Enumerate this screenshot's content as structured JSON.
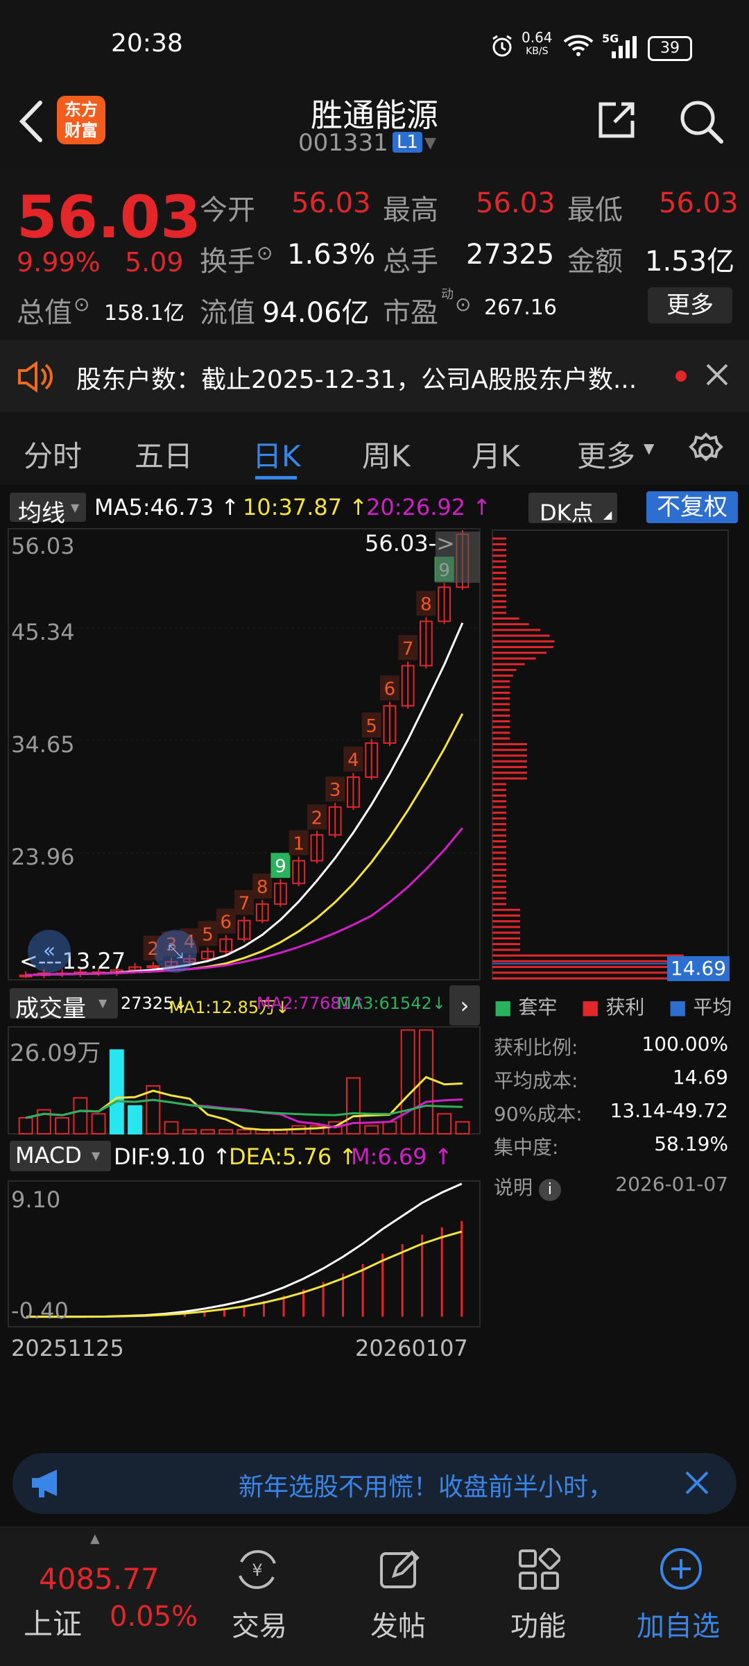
{
  "status": {
    "time": "20:38",
    "speed_value": "0.64",
    "speed_unit": "KB/S",
    "network": "5G",
    "battery": "39"
  },
  "header": {
    "title": "胜通能源",
    "code": "001331",
    "level_badge": "L1",
    "logo_text_1": "东方",
    "logo_text_2": "财富"
  },
  "quote": {
    "price": "56.03",
    "change_pct": "9.99%",
    "change": "5.09",
    "open_label": "今开",
    "open": "56.03",
    "high_label": "最高",
    "high": "56.03",
    "low_label": "最低",
    "low": "56.03",
    "turnover_label": "换手",
    "turnover": "1.63%",
    "volume_label": "总手",
    "volume": "27325",
    "amount_label": "金额",
    "amount": "1.53亿",
    "total_mv_label": "总值",
    "total_mv": "158.1亿",
    "float_mv_label": "流值",
    "float_mv": "94.06亿",
    "pe_label": "市盈",
    "pe_sup": "动",
    "pe": "267.16",
    "more_label": "更多"
  },
  "notice": {
    "text": "股东户数：截止2025-12-31，公司A股股东户数..."
  },
  "tabs": [
    {
      "label": "分时"
    },
    {
      "label": "五日"
    },
    {
      "label": "日K"
    },
    {
      "label": "周K"
    },
    {
      "label": "月K"
    },
    {
      "label": "更多"
    }
  ],
  "ma_bar": {
    "selector": "均线",
    "ma5": "MA5:46.73",
    "ma10": "10:37.87",
    "ma20": "20:26.92",
    "dk": "DK点",
    "fq": "不复权"
  },
  "kline": {
    "y_labels": [
      "56.03",
      "45.34",
      "34.65",
      "23.96"
    ],
    "max_marker": "56.03->",
    "min_marker": "<---13.27",
    "seq_numbers": [
      "2",
      "3",
      "4",
      "5",
      "6",
      "7",
      "8",
      "9",
      "1",
      "2",
      "3",
      "4",
      "5",
      "6",
      "7",
      "8",
      "9"
    ],
    "colors": {
      "up": "#e2262a",
      "ma5": "#ffffff",
      "ma10": "#f5e53a",
      "ma20": "#d21fc9",
      "green": "#29b35a"
    }
  },
  "chip": {
    "price_tag": "14.69",
    "legend": [
      "套牢",
      "获利",
      "平均"
    ],
    "rows": [
      {
        "label": "获利比例:",
        "value": "100.00%"
      },
      {
        "label": "平均成本:",
        "value": "14.69"
      },
      {
        "label": "90%成本:",
        "value": "13.14-49.72"
      },
      {
        "label": "集中度:",
        "value": "58.19%"
      }
    ],
    "note_label": "说明",
    "date": "2026-01-07"
  },
  "volume": {
    "selector": "成交量",
    "vol": "27325",
    "ma1": "MA1:12.85万",
    "ma2": "MA2:77681",
    "ma3": "MA3:61542",
    "max_label": "26.09万"
  },
  "macd": {
    "selector": "MACD",
    "dif": "DIF:9.10",
    "dea": "DEA:5.76",
    "m": "M:6.69",
    "top_label": "9.10",
    "bottom_label": "-0.40"
  },
  "dates": {
    "start": "20251125",
    "end": "20260107"
  },
  "banner": {
    "text": "新年选股不用慌！收盘前半小时，"
  },
  "bottom_nav": {
    "index_value": "4085.77",
    "index_name": "上证",
    "index_change": "0.05%",
    "items": [
      {
        "label": "交易"
      },
      {
        "label": "发帖"
      },
      {
        "label": "功能"
      },
      {
        "label": "加自选"
      }
    ]
  },
  "chart_data": {
    "type": "candlestick",
    "x_range": [
      "20251125",
      "20260107"
    ],
    "ylim": [
      13.27,
      56.03
    ],
    "close_approx": [
      13.3,
      13.5,
      13.4,
      13.6,
      13.5,
      13.8,
      14.1,
      14.2,
      14.6,
      14.9,
      15.6,
      16.8,
      18.6,
      20.2,
      22.2,
      24.4,
      26.9,
      29.6,
      32.5,
      35.8,
      39.4,
      43.3,
      47.6,
      50.9,
      56.03
    ],
    "volume_approx_wan": [
      4,
      6,
      4,
      9,
      5,
      21,
      7,
      12,
      3,
      1,
      1,
      1,
      1,
      1,
      1,
      2,
      2,
      3,
      14,
      2,
      3,
      26,
      26,
      5,
      3
    ],
    "macd_dif_approx": [
      0,
      0,
      0,
      0,
      0.01,
      0.05,
      0.1,
      0.2,
      0.35,
      0.55,
      0.8,
      1.1,
      1.5,
      2.0,
      2.6,
      3.3,
      4.1,
      5.0,
      6.0,
      6.9,
      7.8,
      8.5,
      9.1
    ]
  }
}
